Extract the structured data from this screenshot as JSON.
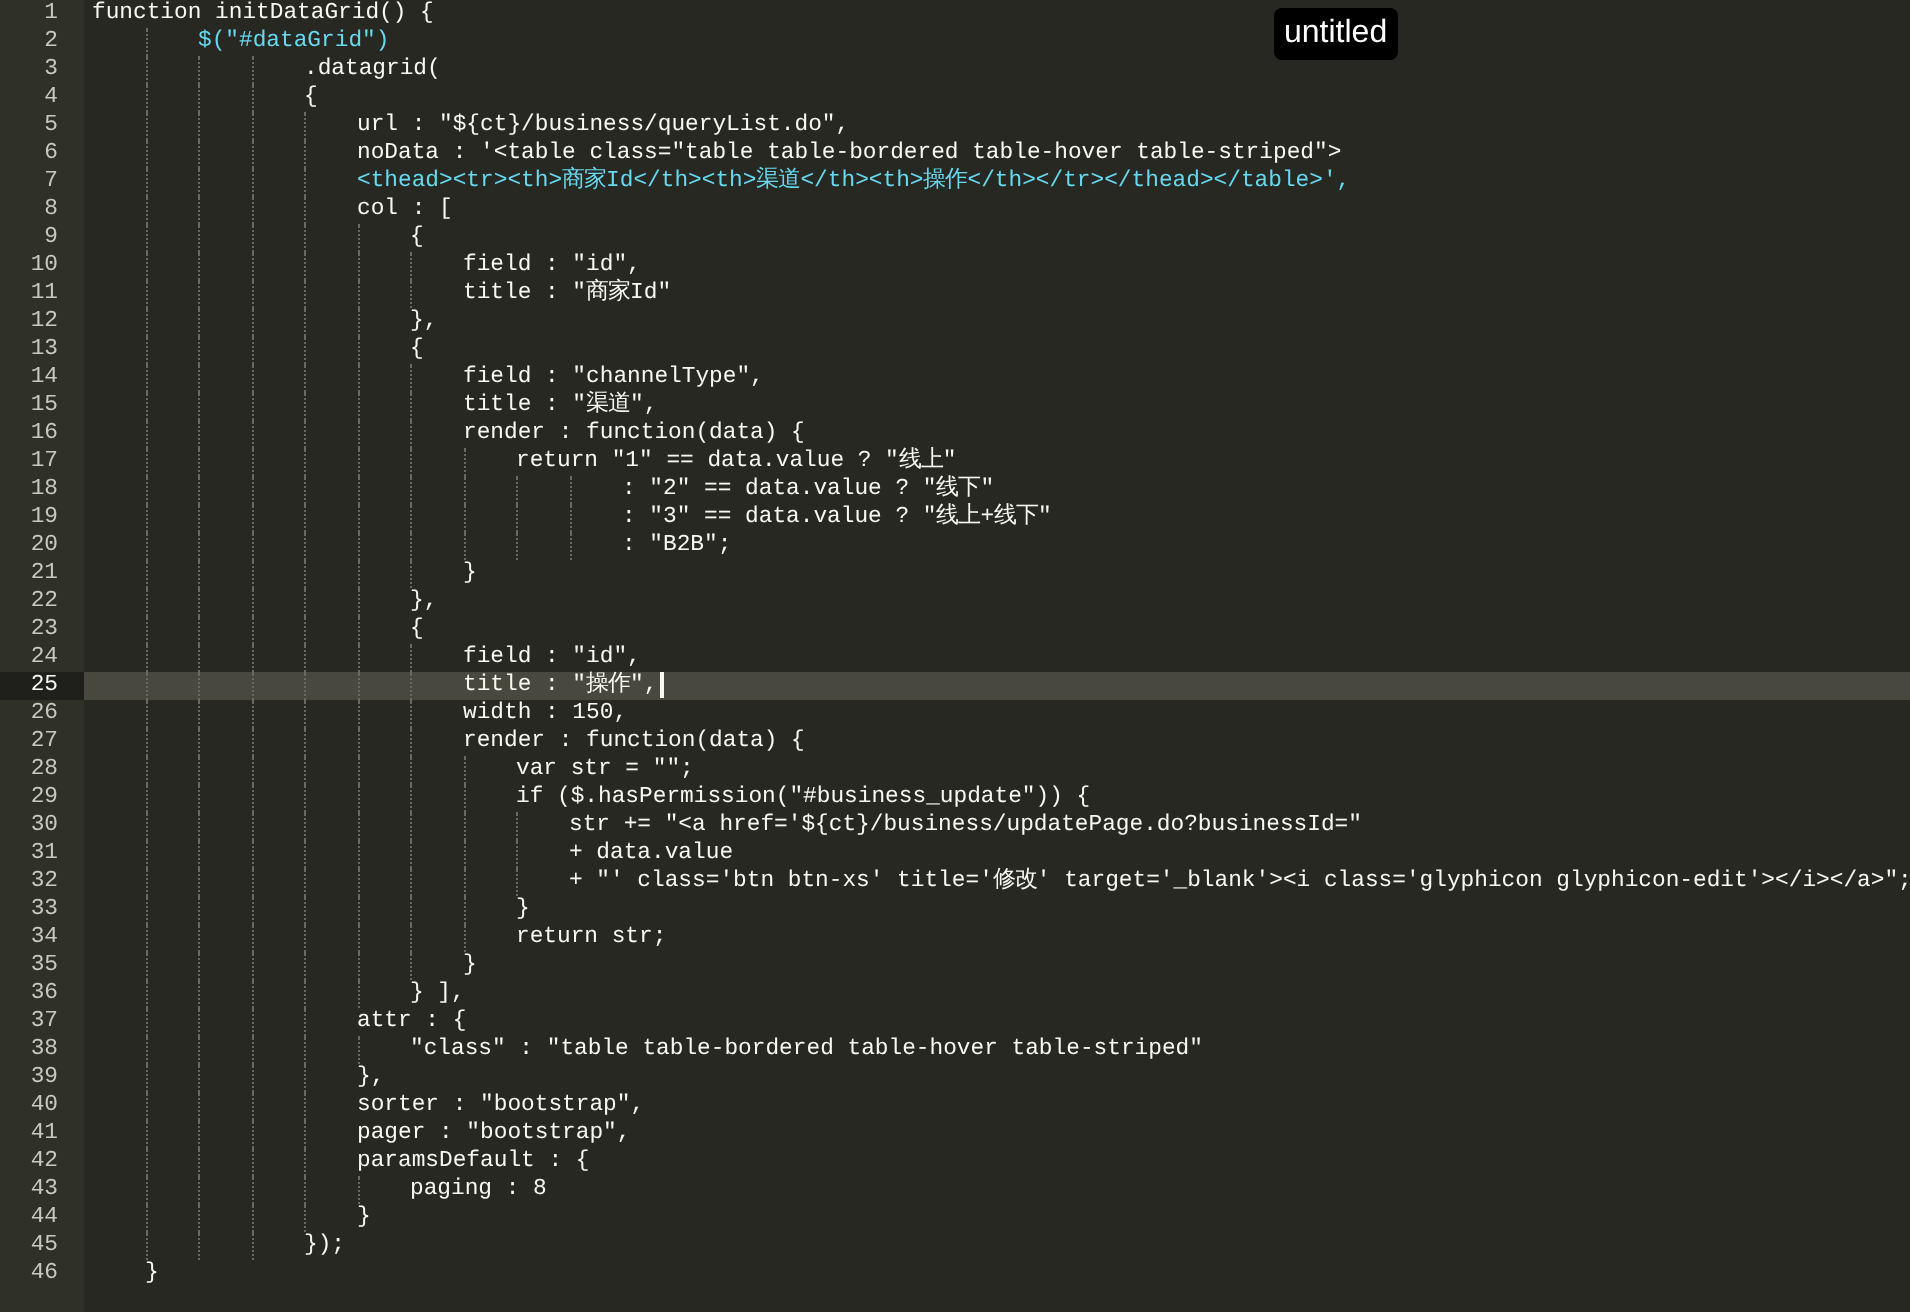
{
  "editor": {
    "lines": [
      {
        "number": "1",
        "text": "function initDataGrid() {",
        "kind": "code",
        "selected": false
      },
      {
        "number": "2",
        "text": "\t\t$(\"#dataGrid\")",
        "kind": "markup",
        "selected": false
      },
      {
        "number": "3",
        "text": "\t\t\t\t.datagrid(",
        "kind": "code",
        "selected": false
      },
      {
        "number": "4",
        "text": "\t\t\t\t{",
        "kind": "code",
        "selected": false
      },
      {
        "number": "5",
        "text": "\t\t\t\t\turl : \"${ct}/business/queryList.do\",",
        "kind": "code",
        "selected": false
      },
      {
        "number": "6",
        "text": "\t\t\t\t\tnoData : '<table class=\"table table-bordered table-hover table-striped\">",
        "kind": "code",
        "selected": false
      },
      {
        "number": "7",
        "text": "\t\t\t\t\t<thead><tr><th>商家Id</th><th>渠道</th><th>操作</th></tr></thead></table>',",
        "kind": "markup",
        "selected": false
      },
      {
        "number": "8",
        "text": "\t\t\t\t\tcol : [",
        "kind": "code",
        "selected": false
      },
      {
        "number": "9",
        "text": "\t\t\t\t\t\t{",
        "kind": "code",
        "selected": false
      },
      {
        "number": "10",
        "text": "\t\t\t\t\t\t\tfield : \"id\",",
        "kind": "code",
        "selected": false
      },
      {
        "number": "11",
        "text": "\t\t\t\t\t\t\ttitle : \"商家Id\"",
        "kind": "code",
        "selected": false
      },
      {
        "number": "12",
        "text": "\t\t\t\t\t\t},",
        "kind": "code",
        "selected": false
      },
      {
        "number": "13",
        "text": "\t\t\t\t\t\t{",
        "kind": "code",
        "selected": false
      },
      {
        "number": "14",
        "text": "\t\t\t\t\t\t\tfield : \"channelType\",",
        "kind": "code",
        "selected": false
      },
      {
        "number": "15",
        "text": "\t\t\t\t\t\t\ttitle : \"渠道\",",
        "kind": "code",
        "selected": false
      },
      {
        "number": "16",
        "text": "\t\t\t\t\t\t\trender : function(data) {",
        "kind": "code",
        "selected": false
      },
      {
        "number": "17",
        "text": "\t\t\t\t\t\t\t\treturn \"1\" == data.value ? \"线上\"",
        "kind": "code",
        "selected": false
      },
      {
        "number": "18",
        "text": "\t\t\t\t\t\t\t\t\t\t: \"2\" == data.value ? \"线下\"",
        "kind": "code",
        "selected": false
      },
      {
        "number": "19",
        "text": "\t\t\t\t\t\t\t\t\t\t: \"3\" == data.value ? \"线上+线下\"",
        "kind": "code",
        "selected": false
      },
      {
        "number": "20",
        "text": "\t\t\t\t\t\t\t\t\t\t: \"B2B\";",
        "kind": "code",
        "selected": false
      },
      {
        "number": "21",
        "text": "\t\t\t\t\t\t\t}",
        "kind": "code",
        "selected": false
      },
      {
        "number": "22",
        "text": "\t\t\t\t\t\t},",
        "kind": "code",
        "selected": false
      },
      {
        "number": "23",
        "text": "\t\t\t\t\t\t{",
        "kind": "code",
        "selected": false
      },
      {
        "number": "24",
        "text": "\t\t\t\t\t\t\tfield : \"id\",",
        "kind": "code",
        "selected": false
      },
      {
        "number": "25",
        "text": "\t\t\t\t\t\t\ttitle : \"操作\",",
        "kind": "code",
        "selected": true
      },
      {
        "number": "26",
        "text": "\t\t\t\t\t\t\twidth : 150,",
        "kind": "code",
        "selected": false
      },
      {
        "number": "27",
        "text": "\t\t\t\t\t\t\trender : function(data) {",
        "kind": "code",
        "selected": false
      },
      {
        "number": "28",
        "text": "\t\t\t\t\t\t\t\tvar str = \"\";",
        "kind": "code",
        "selected": false
      },
      {
        "number": "29",
        "text": "\t\t\t\t\t\t\t\tif ($.hasPermission(\"#business_update\")) {",
        "kind": "code",
        "selected": false
      },
      {
        "number": "30",
        "text": "\t\t\t\t\t\t\t\t\tstr += \"<a href='${ct}/business/updatePage.do?businessId=\"",
        "kind": "code",
        "selected": false
      },
      {
        "number": "31",
        "text": "\t\t\t\t\t\t\t\t\t+ data.value",
        "kind": "code",
        "selected": false
      },
      {
        "number": "32",
        "text": "\t\t\t\t\t\t\t\t\t+ \"' class='btn btn-xs' title='修改' target='_blank'><i class='glyphicon glyphicon-edit'></i></a>\";",
        "kind": "code",
        "selected": false
      },
      {
        "number": "33",
        "text": "\t\t\t\t\t\t\t\t}",
        "kind": "code",
        "selected": false
      },
      {
        "number": "34",
        "text": "\t\t\t\t\t\t\t\treturn str;",
        "kind": "code",
        "selected": false
      },
      {
        "number": "35",
        "text": "\t\t\t\t\t\t\t}",
        "kind": "code",
        "selected": false
      },
      {
        "number": "36",
        "text": "\t\t\t\t\t\t} ],",
        "kind": "code",
        "selected": false
      },
      {
        "number": "37",
        "text": "\t\t\t\t\tattr : {",
        "kind": "code",
        "selected": false
      },
      {
        "number": "38",
        "text": "\t\t\t\t\t\t\"class\" : \"table table-bordered table-hover table-striped\"",
        "kind": "code",
        "selected": false
      },
      {
        "number": "39",
        "text": "\t\t\t\t\t},",
        "kind": "code",
        "selected": false
      },
      {
        "number": "40",
        "text": "\t\t\t\t\tsorter : \"bootstrap\",",
        "kind": "code",
        "selected": false
      },
      {
        "number": "41",
        "text": "\t\t\t\t\tpager : \"bootstrap\",",
        "kind": "code",
        "selected": false
      },
      {
        "number": "42",
        "text": "\t\t\t\t\tparamsDefault : {",
        "kind": "code",
        "selected": false
      },
      {
        "number": "43",
        "text": "\t\t\t\t\t\tpaging : 8",
        "kind": "code",
        "selected": false
      },
      {
        "number": "44",
        "text": "\t\t\t\t\t}",
        "kind": "code",
        "selected": false
      },
      {
        "number": "45",
        "text": "\t\t\t\t});",
        "kind": "code",
        "selected": false
      },
      {
        "number": "46",
        "text": "\t}",
        "kind": "code",
        "selected": false
      }
    ]
  },
  "badge": {
    "title": "untitled"
  }
}
